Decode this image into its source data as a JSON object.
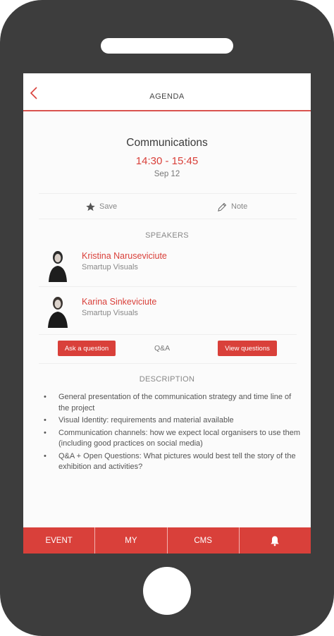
{
  "header": {
    "title": "AGENDA"
  },
  "session": {
    "title": "Communications",
    "time": "14:30 - 15:45",
    "date": "Sep 12"
  },
  "actions": {
    "save": "Save",
    "note": "Note"
  },
  "speakers_label": "SPEAKERS",
  "speakers": [
    {
      "name": "Kristina Naruseviciute",
      "company": "Smartup Visuals"
    },
    {
      "name": "Karina Sinkeviciute",
      "company": "Smartup Visuals"
    }
  ],
  "qa": {
    "ask": "Ask a question",
    "label": "Q&A",
    "view": "View questions"
  },
  "description_label": "DESCRIPTION",
  "description": [
    "General presentation of the communication strategy and time line of the project",
    "Visual Identity: requirements and material available",
    "Communication channels: how we expect local organisers to use them (including good practices on social media)",
    "Q&A + Open Questions: What pictures would best tell the story of the exhibition and activities?"
  ],
  "tabs": [
    {
      "label": "EVENT"
    },
    {
      "label": "MY"
    },
    {
      "label": "CMS"
    },
    {
      "label": "",
      "icon": "bell-icon"
    }
  ],
  "colors": {
    "accent": "#d9403a",
    "phone_body": "#3d3d3d"
  }
}
